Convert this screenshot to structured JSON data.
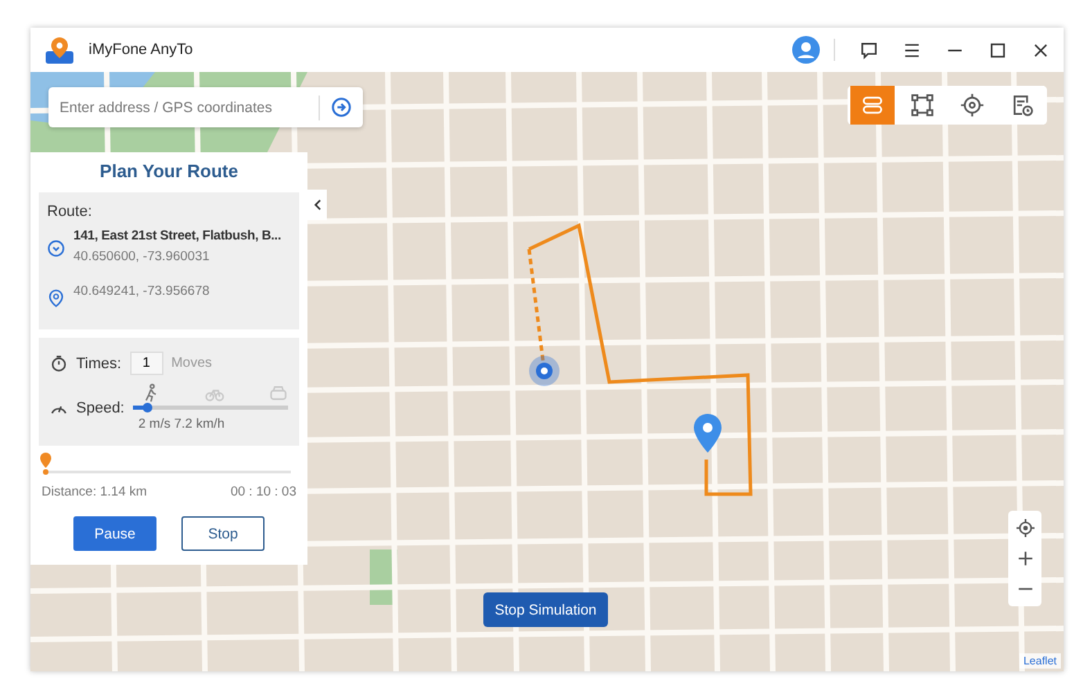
{
  "app": {
    "title": "iMyFone AnyTo"
  },
  "search": {
    "placeholder": "Enter address / GPS coordinates"
  },
  "map_modes": [
    {
      "kind": "route",
      "selected": true
    },
    {
      "kind": "points",
      "selected": false
    },
    {
      "kind": "target",
      "selected": false
    },
    {
      "kind": "history",
      "selected": false
    }
  ],
  "panel": {
    "title": "Plan Your Route",
    "route_label": "Route:",
    "stops": [
      {
        "kind": "start",
        "name": "141, East 21st Street, Flatbush, B...",
        "coords": "40.650600, -73.960031"
      },
      {
        "kind": "end",
        "coords": "40.649241, -73.956678"
      }
    ],
    "times_label": "Times:",
    "times_value": "1",
    "times_unit": "Moves",
    "speed_label": "Speed:",
    "speed_modes": [
      {
        "kind": "walk",
        "selected": true
      },
      {
        "kind": "bike",
        "selected": false
      },
      {
        "kind": "car",
        "selected": false
      }
    ],
    "speed": {
      "level": 0.1,
      "reading": "2 m/s 7.2 km/h"
    },
    "progress": {
      "level": 0
    },
    "distance": "Distance: 1.14 km",
    "elapsed": "00 : 10 : 03",
    "buttons": [
      {
        "label": "Pause",
        "kind": "primary"
      },
      {
        "label": "Stop",
        "kind": "secondary"
      }
    ]
  },
  "map": {
    "stop_button": "Stop Simulation",
    "attribution": "Leaflet"
  }
}
